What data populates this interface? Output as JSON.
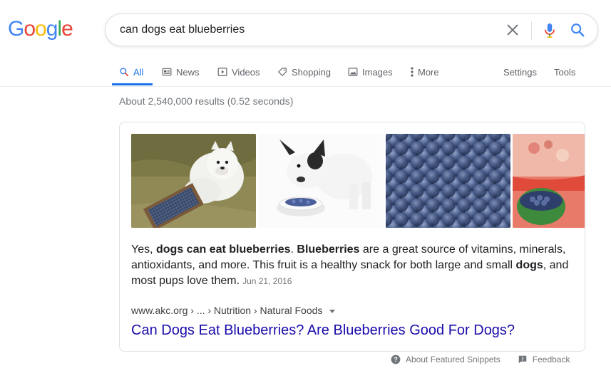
{
  "logo": {
    "letters": [
      "G",
      "o",
      "o",
      "g",
      "l",
      "e"
    ],
    "colors": [
      "#4285f4",
      "#ea4335",
      "#fbbc05",
      "#4285f4",
      "#34a853",
      "#ea4335"
    ]
  },
  "search": {
    "query": "can dogs eat blueberries"
  },
  "tabs": [
    {
      "label": "All",
      "icon": "search-icon",
      "active": true
    },
    {
      "label": "News",
      "icon": "news-icon"
    },
    {
      "label": "Videos",
      "icon": "video-icon"
    },
    {
      "label": "Shopping",
      "icon": "tag-icon"
    },
    {
      "label": "Images",
      "icon": "image-icon"
    },
    {
      "label": "More",
      "icon": "more-vert-icon"
    }
  ],
  "tools": {
    "settings": "Settings",
    "tools": "Tools"
  },
  "result_stats": "About 2,540,000 results (0.52 seconds)",
  "featured_snippet": {
    "images": [
      {
        "description": "white dog with blueberries"
      },
      {
        "description": "french bulldog eating blueberries"
      },
      {
        "description": "blueberries close-up"
      },
      {
        "description": "bowl of blueberries"
      }
    ],
    "text": {
      "p1": "Yes, ",
      "b1": "dogs can eat blueberries",
      "p2": ". ",
      "b2": "Blueberries",
      "p3": " are a great source of vitamins, minerals, antioxidants, and more. This fruit is a healthy snack for both large and small ",
      "b3": "dogs",
      "p4": ", and most pups love them."
    },
    "date": "Jun 21, 2016",
    "cite": "www.akc.org › ... › Nutrition › Natural Foods",
    "title": "Can Dogs Eat Blueberries? Are Blueberries Good For Dogs?"
  },
  "footer": {
    "about": "About Featured Snippets",
    "feedback": "Feedback"
  },
  "colors": {
    "accent": "#1a73e8",
    "link": "#1a0dab"
  }
}
